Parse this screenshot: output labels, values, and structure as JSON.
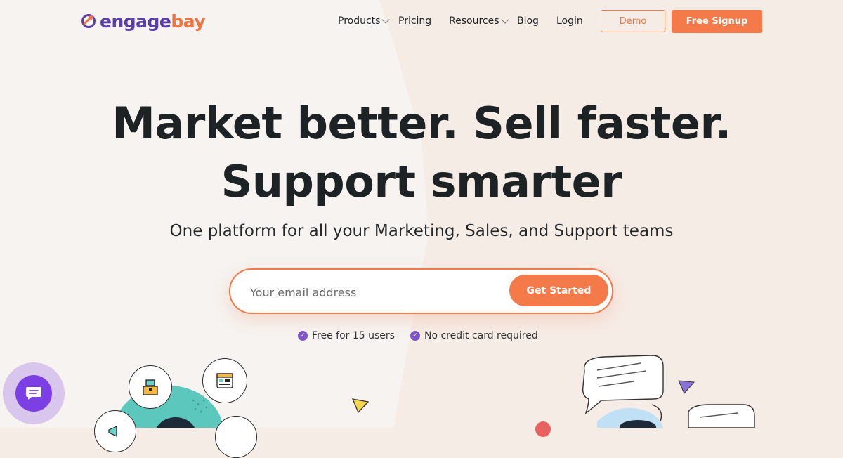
{
  "brand": {
    "logo_part1": "engage",
    "logo_part2": "bay"
  },
  "nav": {
    "items": [
      {
        "label": "Products"
      },
      {
        "label": "Pricing"
      },
      {
        "label": "Resources"
      },
      {
        "label": "Blog"
      },
      {
        "label": "Login"
      }
    ],
    "demo_label": "Demo",
    "signup_label": "Free Signup"
  },
  "hero": {
    "line1": "Market better. Sell faster.",
    "line2": "Support smarter",
    "subtitle": "One platform for all your Marketing, Sales, and Support teams"
  },
  "signup": {
    "email_placeholder": "Your email address",
    "button_label": "Get Started"
  },
  "perks": [
    {
      "label": "Free for 15 users"
    },
    {
      "label": "No credit card required"
    }
  ],
  "colors": {
    "accent": "#f47a49",
    "brand_purple": "#5b3fa8",
    "check_purple": "#7d55c7",
    "chat_purple": "#7b3fe4",
    "teal": "#5cc7bd"
  },
  "icons": {
    "logo": "engagebay-logo-icon",
    "check": "check-circle-icon",
    "chat": "chat-bubble-icon"
  }
}
